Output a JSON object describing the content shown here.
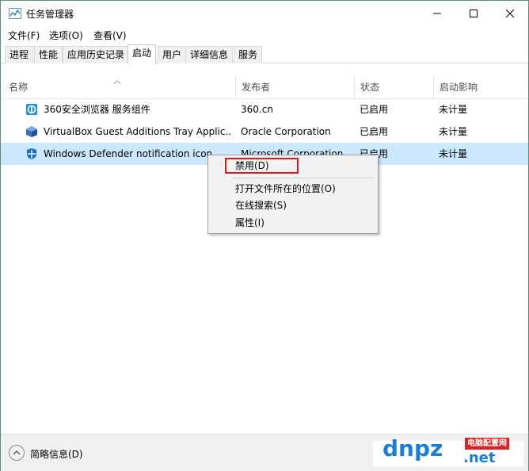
{
  "window": {
    "title": "任务管理器"
  },
  "menu": [
    "文件(F)",
    "选项(O)",
    "查看(V)"
  ],
  "tabs": [
    {
      "label": "进程",
      "active": false
    },
    {
      "label": "性能",
      "active": false
    },
    {
      "label": "应用历史记录",
      "active": false
    },
    {
      "label": "启动",
      "active": true
    },
    {
      "label": "用户",
      "active": false
    },
    {
      "label": "详细信息",
      "active": false
    },
    {
      "label": "服务",
      "active": false
    }
  ],
  "columns": {
    "name": "名称",
    "publisher": "发布者",
    "status": "状态",
    "impact": "启动影响"
  },
  "rows": [
    {
      "name": "360安全浏览器 服务组件",
      "publisher": "360.cn",
      "status": "已启用",
      "impact": "未计量",
      "icon": "browser-360-icon"
    },
    {
      "name": "VirtualBox Guest Additions Tray Applic...",
      "publisher": "Oracle Corporation",
      "status": "已启用",
      "impact": "未计量",
      "icon": "virtualbox-icon"
    },
    {
      "name": "Windows Defender notification icon",
      "publisher": "Microsoft Corporation",
      "status": "已启用",
      "impact": "未计量",
      "icon": "defender-shield-icon",
      "selected": true
    }
  ],
  "context_menu": {
    "disable": "禁用(D)",
    "open_location": "打开文件所在的位置(O)",
    "search_online": "在线搜索(S)",
    "properties": "属性(I)"
  },
  "footer": {
    "fewer_details": "简略信息(D)"
  },
  "watermark": {
    "logo": "dnpz",
    "badge": "电脑配置网",
    "domain": ".net"
  },
  "colors": {
    "selection": "#cce8ff",
    "highlight_box": "#e01818",
    "watermark": "#1a7fd4"
  }
}
